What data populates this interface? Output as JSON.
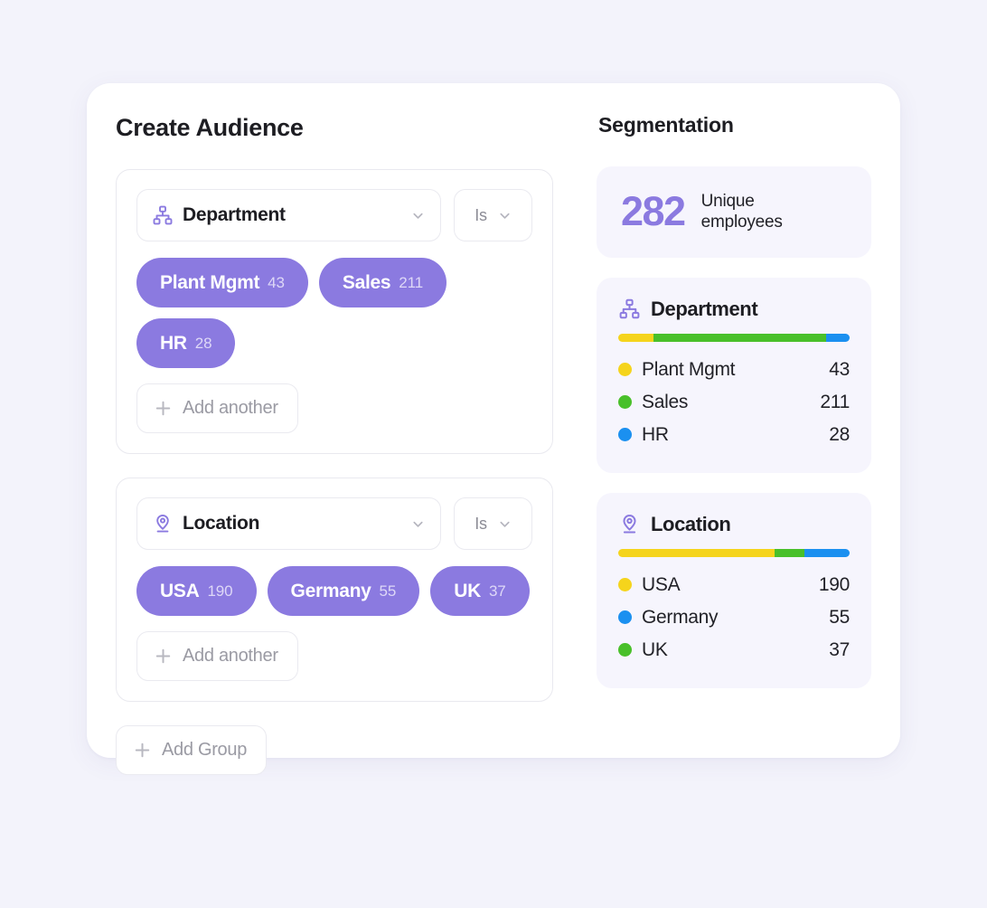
{
  "left": {
    "title": "Create Audience",
    "groups": [
      {
        "field_icon": "org-chart-icon",
        "field_label": "Department",
        "operator_label": "Is",
        "chips": [
          {
            "label": "Plant Mgmt",
            "count": "43"
          },
          {
            "label": "Sales",
            "count": "211"
          },
          {
            "label": "HR",
            "count": "28"
          }
        ],
        "add_label": "Add another"
      },
      {
        "field_icon": "map-pin-icon",
        "field_label": "Location",
        "operator_label": "Is",
        "chips": [
          {
            "label": "USA",
            "count": "190"
          },
          {
            "label": "Germany",
            "count": "55"
          },
          {
            "label": "UK",
            "count": "37"
          }
        ],
        "add_label": "Add another"
      }
    ],
    "add_group_label": "Add Group"
  },
  "right": {
    "title": "Segmentation",
    "unique": {
      "value": "282",
      "label_line1": "Unique",
      "label_line2": "employees"
    },
    "cards": [
      {
        "icon": "org-chart-icon",
        "title": "Department",
        "items": [
          {
            "label": "Plant Mgmt",
            "value": "43",
            "color": "#f5d41c"
          },
          {
            "label": "Sales",
            "value": "211",
            "color": "#49c02a"
          },
          {
            "label": "HR",
            "value": "28",
            "color": "#1b90f0"
          }
        ]
      },
      {
        "icon": "map-pin-icon",
        "title": "Location",
        "items": [
          {
            "label": "USA",
            "value": "190",
            "color": "#f5d41c"
          },
          {
            "label": "Germany",
            "value": "55",
            "color": "#1b90f0"
          },
          {
            "label": "UK",
            "value": "37",
            "color": "#49c02a"
          }
        ]
      }
    ]
  },
  "colors": {
    "accent_purple": "#8b7ae0",
    "page_bg": "#f3f3fb",
    "card_bg": "#f6f5fd",
    "yellow": "#f5d41c",
    "green": "#49c02a",
    "blue": "#1b90f0"
  },
  "chart_data": [
    {
      "type": "bar",
      "title": "Department",
      "categories": [
        "Plant Mgmt",
        "Sales",
        "HR"
      ],
      "values": [
        43,
        211,
        28
      ],
      "colors": [
        "#f5d41c",
        "#49c02a",
        "#1b90f0"
      ],
      "segments_percent": [
        15.2,
        74.8,
        10.0
      ],
      "total": 282,
      "xlabel": "",
      "ylabel": "",
      "grid": false,
      "legend": "below"
    },
    {
      "type": "bar",
      "title": "Location",
      "categories": [
        "USA",
        "Germany",
        "UK"
      ],
      "values": [
        190,
        55,
        37
      ],
      "colors": [
        "#f5d41c",
        "#1b90f0",
        "#49c02a"
      ],
      "segments_percent": [
        67.4,
        13.1,
        19.5
      ],
      "segments_order": [
        "USA",
        "UK",
        "Germany"
      ],
      "total": 282,
      "xlabel": "",
      "ylabel": "",
      "grid": false,
      "legend": "below"
    }
  ]
}
